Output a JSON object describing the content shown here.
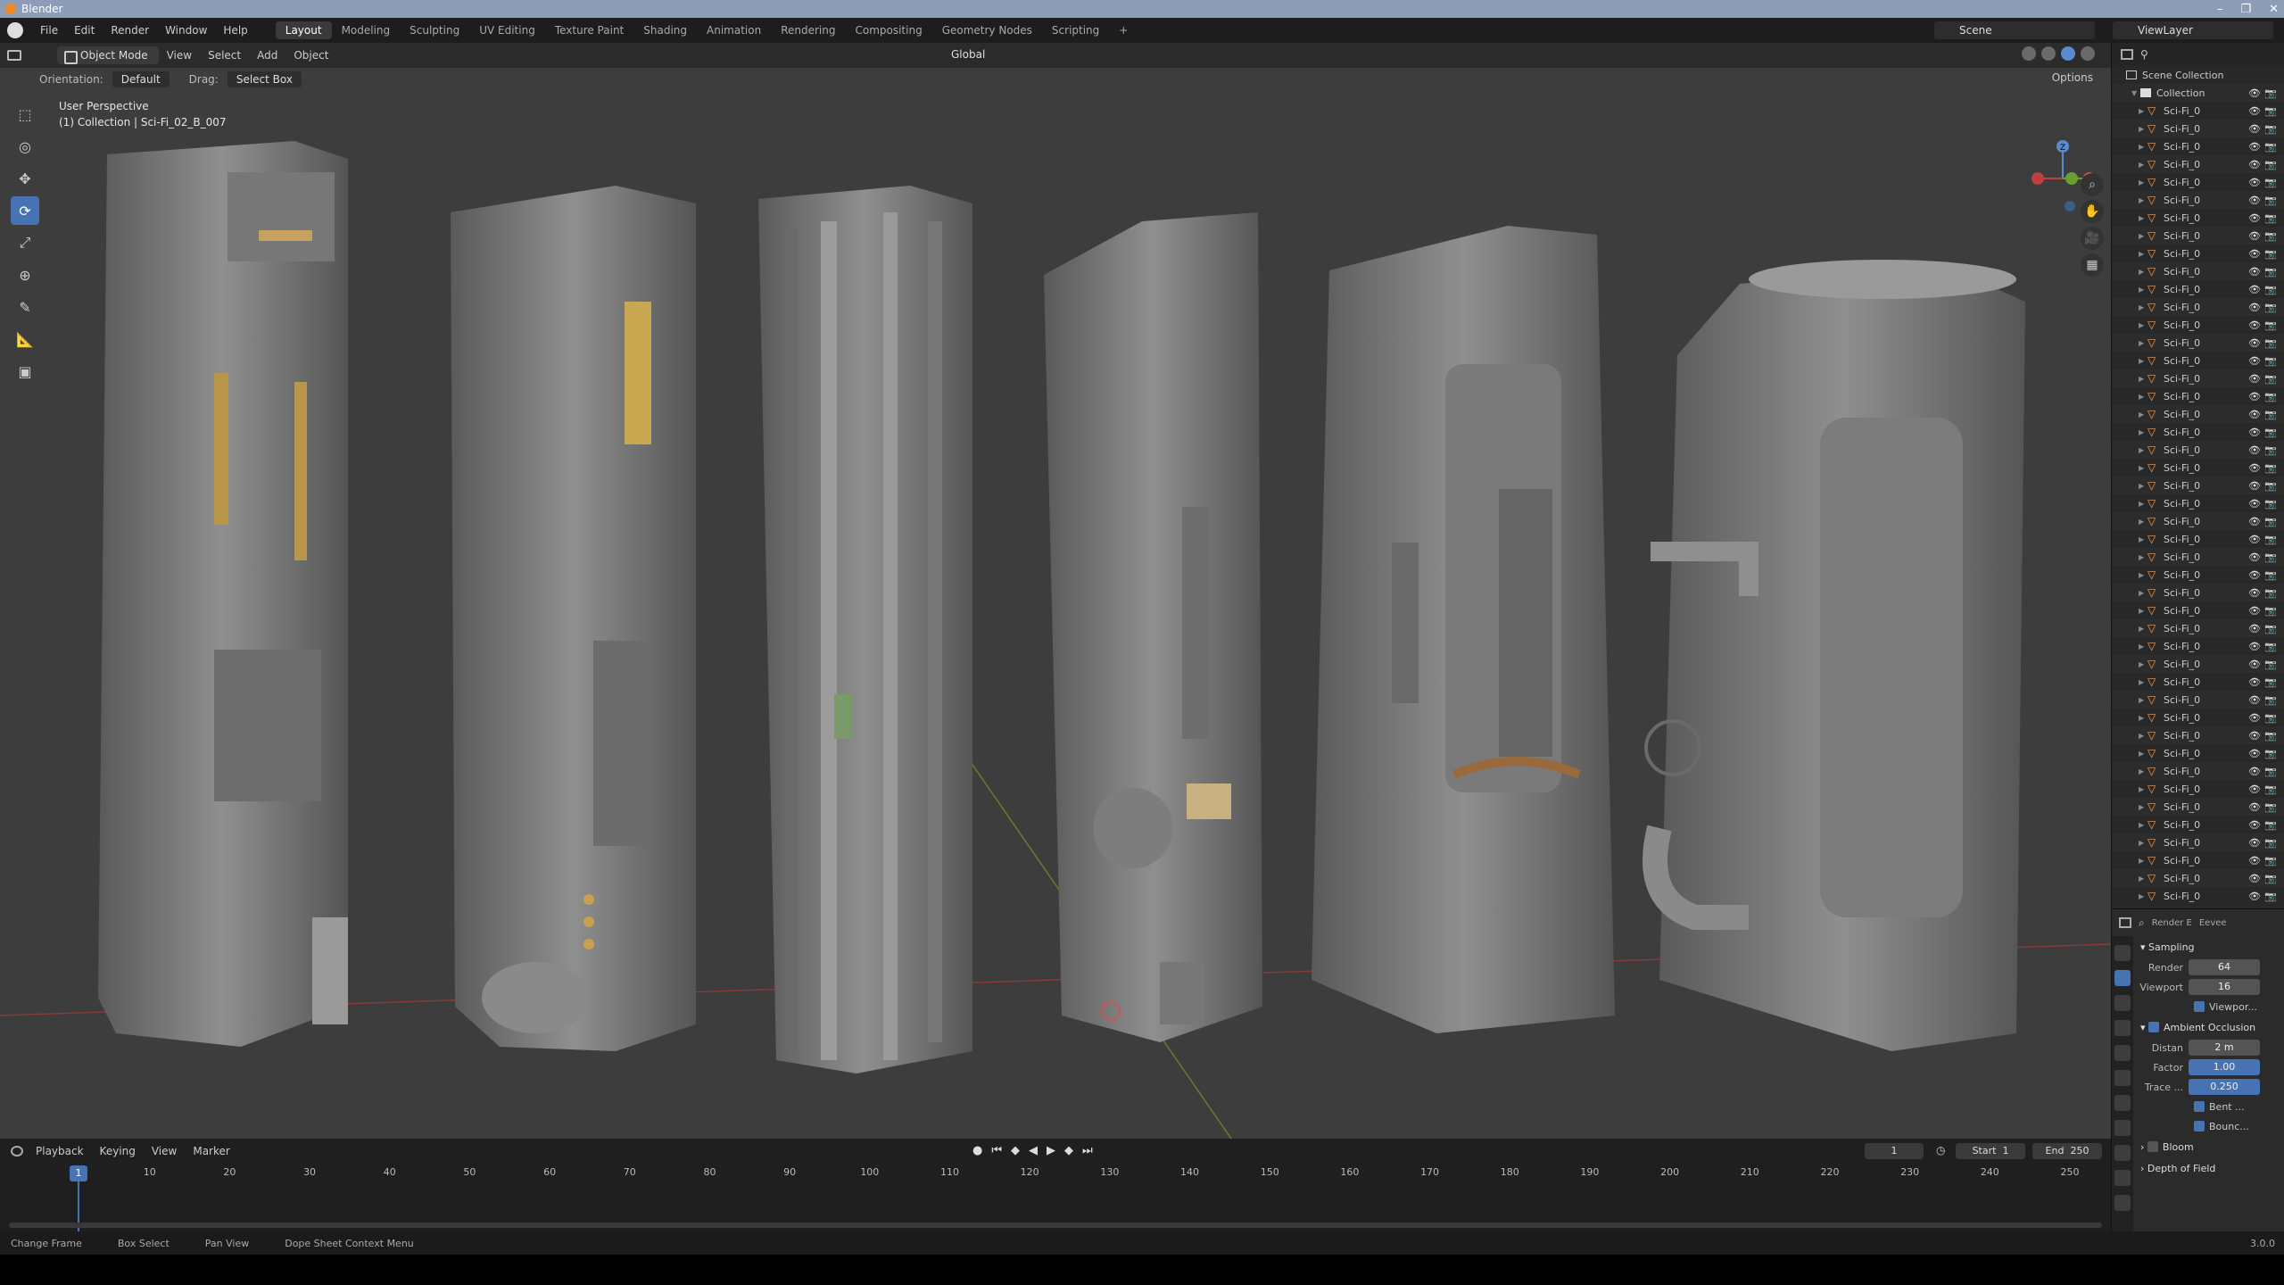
{
  "app": {
    "title": "Blender",
    "version": "3.0.0"
  },
  "menubar": {
    "menus": [
      "File",
      "Edit",
      "Render",
      "Window",
      "Help"
    ],
    "workspaces": [
      "Layout",
      "Modeling",
      "Sculpting",
      "UV Editing",
      "Texture Paint",
      "Shading",
      "Animation",
      "Rendering",
      "Compositing",
      "Geometry Nodes",
      "Scripting"
    ],
    "active_workspace": "Layout",
    "scene": "Scene",
    "view_layer": "ViewLayer"
  },
  "viewport": {
    "mode": "Object Mode",
    "menus": [
      "View",
      "Select",
      "Add",
      "Object"
    ],
    "transform_orientation": "Global",
    "orientation_label": "Orientation:",
    "orientation_value": "Default",
    "drag_label": "Drag:",
    "drag_value": "Select Box",
    "options_label": "Options",
    "info_line1": "User Perspective",
    "info_line2": "(1) Collection | Sci-Fi_02_B_007",
    "gizmo_axis_label": "Z"
  },
  "outliner": {
    "root": "Scene Collection",
    "collection": "Collection",
    "object_label": "Sci-Fi_0",
    "visible_object_count": 45
  },
  "properties": {
    "tabs": [
      "Render E",
      "Eevee"
    ],
    "sampling_title": "Sampling",
    "render_label": "Render",
    "render_value": "64",
    "viewport_label": "Viewport",
    "viewport_value": "16",
    "viewport_denoise": "Viewpor...",
    "ao_title": "Ambient Occlusion",
    "distance_label": "Distan",
    "distance_value": "2 m",
    "factor_label": "Factor",
    "factor_value": "1.00",
    "trace_label": "Trace ...",
    "trace_value": "0.250",
    "bent_label": "Bent ...",
    "bounce_label": "Bounc...",
    "bloom_title": "Bloom",
    "dof_title": "Depth of Field"
  },
  "timeline": {
    "menus": [
      "Playback",
      "Keying",
      "View",
      "Marker"
    ],
    "current_frame": "1",
    "start_label": "Start",
    "start_value": "1",
    "end_label": "End",
    "end_value": "250",
    "ruler_ticks": [
      "10",
      "20",
      "30",
      "40",
      "50",
      "60",
      "70",
      "80",
      "90",
      "100",
      "110",
      "120",
      "130",
      "140",
      "150",
      "160",
      "170",
      "180",
      "190",
      "200",
      "210",
      "220",
      "230",
      "240",
      "250"
    ]
  },
  "statusbar": {
    "hints": [
      "Change Frame",
      "Box Select",
      "Pan View",
      "Dope Sheet Context Menu"
    ]
  },
  "colors": {
    "accent": "#4772b3",
    "viewport_bg": "#3d3d3d",
    "mesh_icon": "#f0a060"
  }
}
